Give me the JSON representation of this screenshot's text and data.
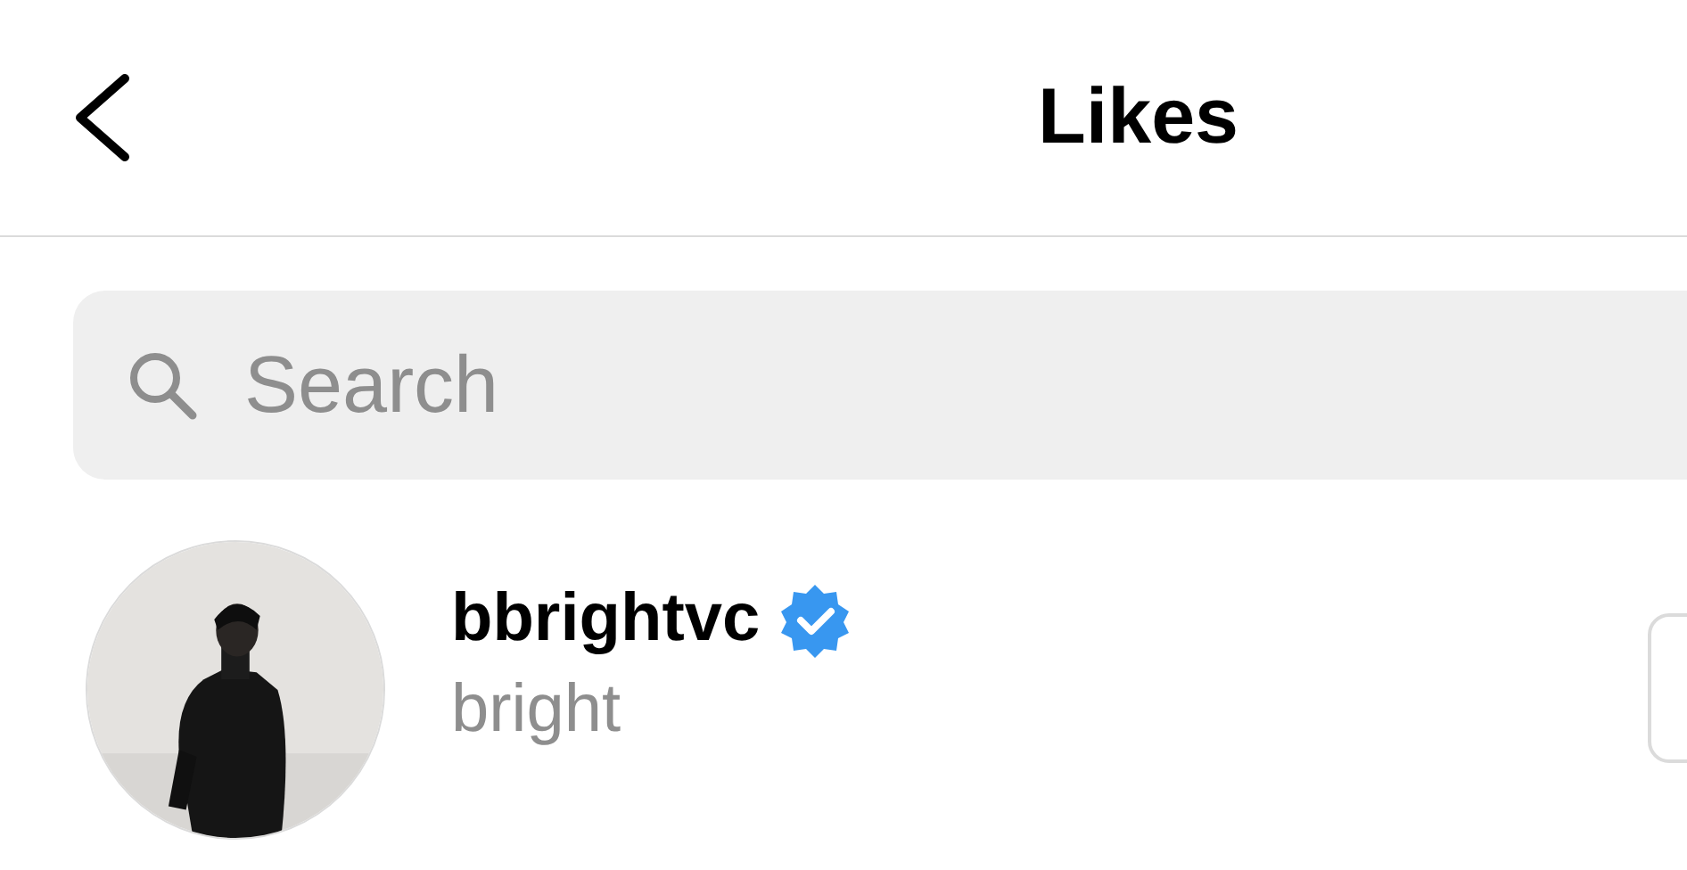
{
  "header": {
    "title": "Likes"
  },
  "search": {
    "placeholder": "Search"
  },
  "users": [
    {
      "username": "bbrightvc",
      "verified": true,
      "name": "bright"
    }
  ]
}
